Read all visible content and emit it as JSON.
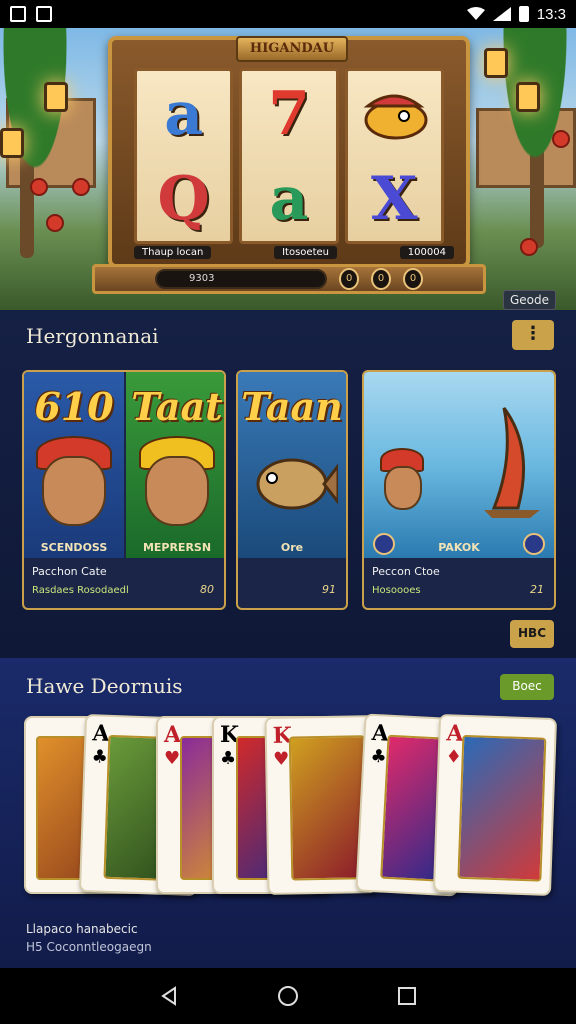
{
  "status_bar": {
    "time": "13:3"
  },
  "hero": {
    "machine_title": "HIGANDAU",
    "reel_symbols": [
      [
        "a",
        "Q"
      ],
      [
        "7",
        "a"
      ],
      [
        "fish",
        "X"
      ]
    ],
    "reel_labels": [
      "Thaup locan",
      "Itosoeteu",
      "100004"
    ],
    "base_display": "9303",
    "base_buttons": [
      "0",
      "0",
      "0"
    ],
    "corner_button": "Geode"
  },
  "featured": {
    "title": "Hergonnanai",
    "menu_label": "⋮",
    "cards": [
      {
        "art_title": "610",
        "caption": "SCENDOSS",
        "name": "Pacchon Cate",
        "sub": "Rasdaes Rosodaedl",
        "num": "80"
      },
      {
        "art_title": "Taat",
        "caption": "MEPRERSN",
        "name": "",
        "sub": "",
        "num": ""
      },
      {
        "art_title": "Taan",
        "caption": "Ore",
        "name": "",
        "sub": "",
        "num": "91"
      },
      {
        "art_title": "",
        "caption": "PAKOK",
        "name": "Peccon Ctoe",
        "sub": "Hosoooes",
        "num": "21"
      }
    ],
    "more_label": "HBC"
  },
  "cards_section": {
    "title": "Hawe Deornuis",
    "button_label": "Boec",
    "playing_cards": [
      {
        "rank": "",
        "suit": ""
      },
      {
        "rank": "A",
        "suit": "♣"
      },
      {
        "rank": "A",
        "suit": "♥"
      },
      {
        "rank": "K",
        "suit": "♣"
      },
      {
        "rank": "K",
        "suit": "♥"
      },
      {
        "rank": "A",
        "suit": "♣"
      },
      {
        "rank": "A",
        "suit": "♦"
      }
    ],
    "footer_line1": "Llapaco hanabecic",
    "footer_line2": "H5 Coconntleogaegn"
  },
  "colors": {
    "gold": "#c9a24a",
    "navy": "#152045",
    "green": "#6a9a2a"
  }
}
